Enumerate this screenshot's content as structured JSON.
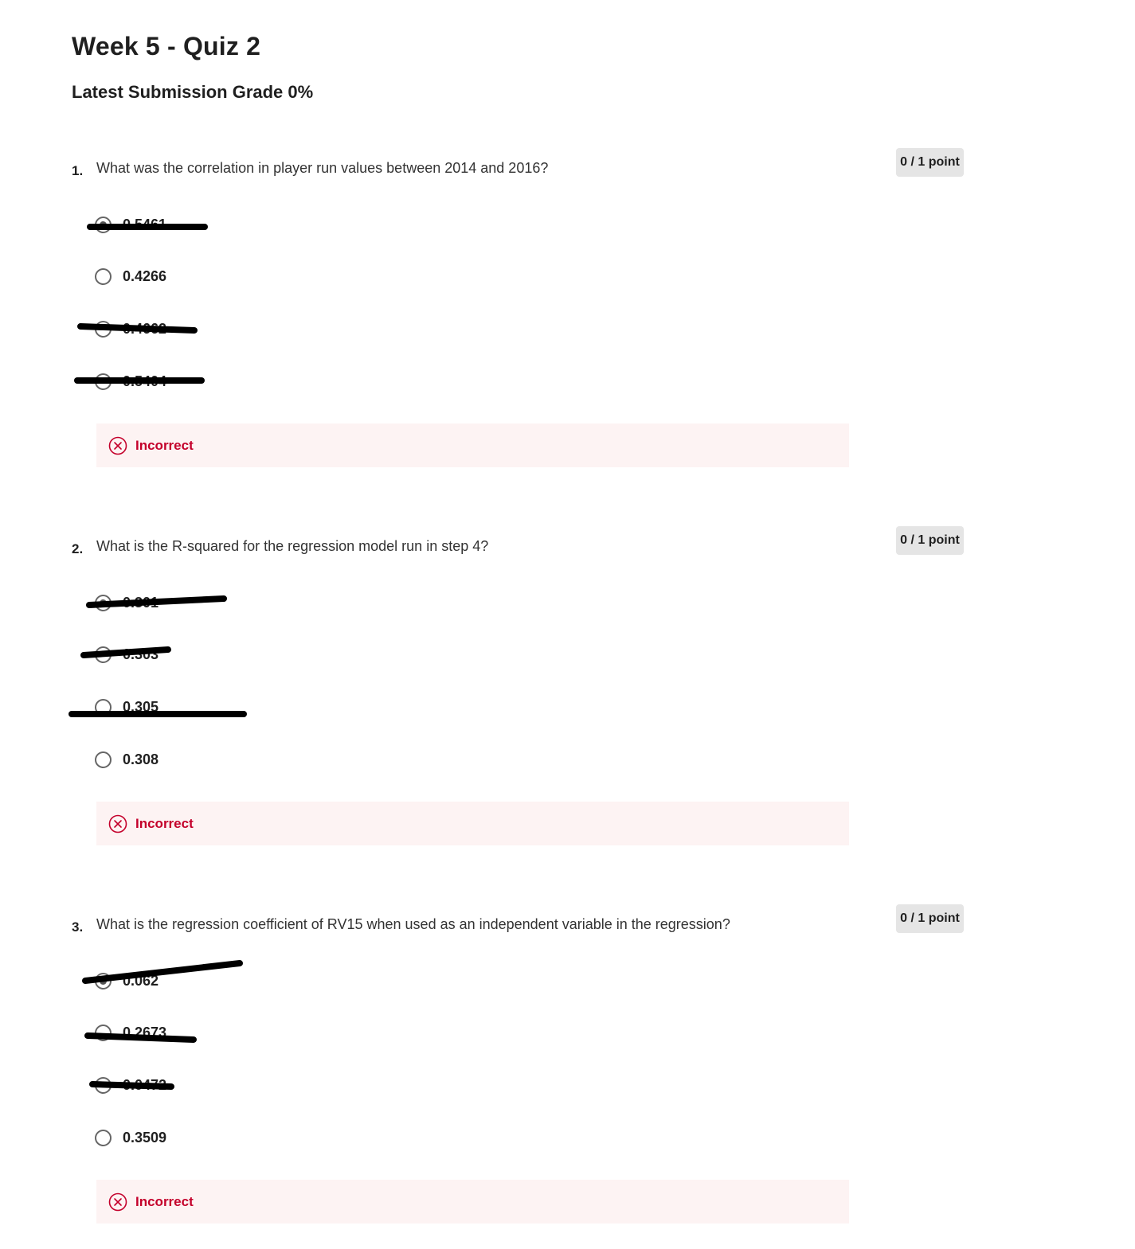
{
  "page": {
    "title": "Week 5 - Quiz 2",
    "grade_label": "Latest Submission Grade 0%"
  },
  "questions": [
    {
      "number": "1.",
      "text": "What was the correlation in player run values between 2014 and 2016?",
      "points": "0 / 1 point",
      "options": [
        {
          "label": "0.5461",
          "selected": true
        },
        {
          "label": "0.4266",
          "selected": false
        },
        {
          "label": "0.4662",
          "selected": false
        },
        {
          "label": "0.5404",
          "selected": false
        }
      ],
      "feedback": "Incorrect"
    },
    {
      "number": "2.",
      "text": "What is the R-squared for the regression model run in step 4?",
      "points": "0 / 1 point",
      "options": [
        {
          "label": "0.301",
          "selected": true
        },
        {
          "label": "0.303",
          "selected": false
        },
        {
          "label": "0.305",
          "selected": false
        },
        {
          "label": "0.308",
          "selected": false
        }
      ],
      "feedback": "Incorrect"
    },
    {
      "number": "3.",
      "text": "What is the regression coefficient of RV15 when used as an independent variable in the regression?",
      "points": "0 / 1 point",
      "options": [
        {
          "label": "0.062",
          "selected": true
        },
        {
          "label": "0.2673",
          "selected": false
        },
        {
          "label": "0.0472",
          "selected": false
        },
        {
          "label": "0.3509",
          "selected": false
        }
      ],
      "feedback": "Incorrect"
    }
  ],
  "colors": {
    "incorrect_text": "#c4002b",
    "feedback_bg": "#fdf3f3",
    "points_bg": "#e5e5e5",
    "scribble": "#000000"
  },
  "icons": {
    "feedback": "error-circle-x-icon",
    "option": "radio-button-icon"
  }
}
